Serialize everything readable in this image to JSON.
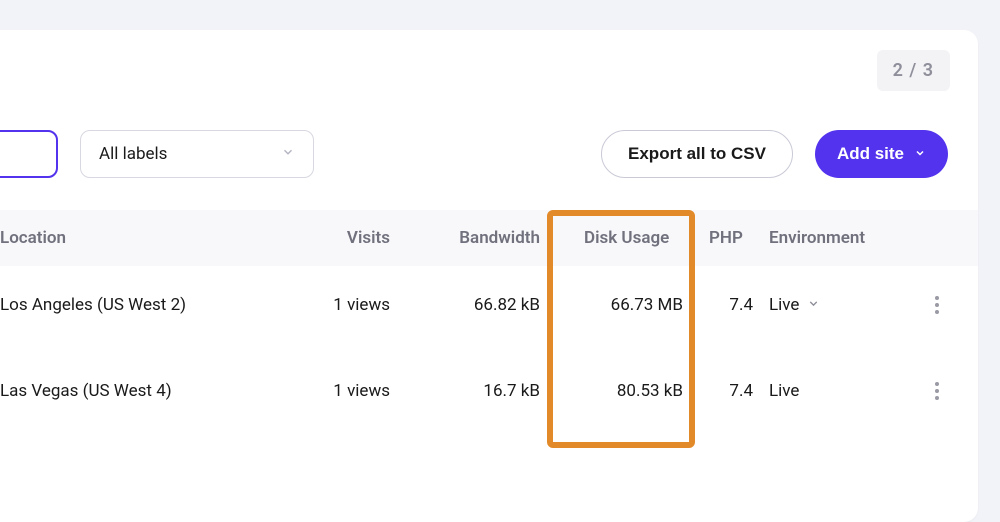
{
  "pagination": {
    "text": "2 / 3"
  },
  "toolbar": {
    "labels_select": "All labels",
    "export_btn": "Export all to CSV",
    "addsite_btn": "Add site"
  },
  "table": {
    "headers": {
      "location": "Location",
      "visits": "Visits",
      "bandwidth": "Bandwidth",
      "disk": "Disk Usage",
      "php": "PHP",
      "environment": "Environment"
    },
    "rows": [
      {
        "location": "Los Angeles (US West 2)",
        "visits": "1 views",
        "bandwidth": "66.82 kB",
        "disk": "66.73 MB",
        "php": "7.4",
        "environment": "Live",
        "has_env_dropdown": true
      },
      {
        "location": "Las Vegas (US West 4)",
        "visits": "1 views",
        "bandwidth": "16.7 kB",
        "disk": "80.53 kB",
        "php": "7.4",
        "environment": "Live",
        "has_env_dropdown": false
      }
    ]
  },
  "colors": {
    "accent": "#5333ed",
    "highlight": "#e28a2a"
  }
}
